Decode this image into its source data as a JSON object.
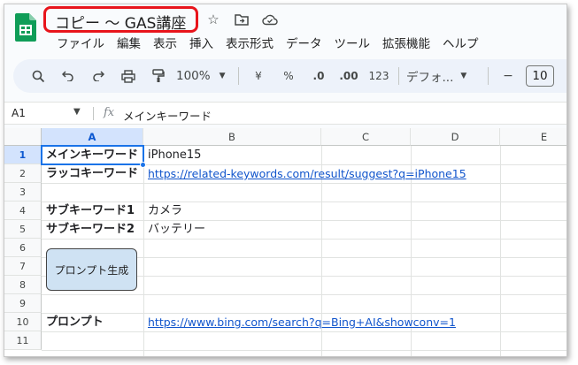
{
  "doc": {
    "title": "コピー 〜 GAS講座"
  },
  "menu": [
    "ファイル",
    "編集",
    "表示",
    "挿入",
    "表示形式",
    "データ",
    "ツール",
    "拡張機能",
    "ヘルプ"
  ],
  "toolbar": {
    "zoom": "100%",
    "currency": "¥",
    "percent": "%",
    "dec_decrease": ".0",
    "dec_increase": ".00",
    "num_format": "123",
    "font": "デフォ...",
    "font_size": "10",
    "minus": "−",
    "plus": "+"
  },
  "formula_bar": {
    "name_box": "A1",
    "fx": "fx",
    "value": "メインキーワード"
  },
  "columns": [
    "A",
    "B",
    "C",
    "D",
    "E"
  ],
  "rows": [
    "1",
    "2",
    "3",
    "4",
    "5",
    "6",
    "7",
    "8",
    "9",
    "10",
    "11"
  ],
  "cells": {
    "a1": "メインキーワード",
    "b1": "iPhone15",
    "a2": "ラッコキーワード",
    "b2": "https://related-keywords.com/result/suggest?q=iPhone15",
    "a4": "サブキーワード1",
    "b4": "カメラ",
    "a5": "サブキーワード2",
    "b5": "バッテリー",
    "a10": "プロンプト",
    "b10": "https://www.bing.com/search?q=Bing+AI&showconv=1"
  },
  "drawing_button": {
    "label": "プロンプト生成"
  },
  "colors": {
    "accent": "#1a73e8",
    "link": "#1155cc",
    "highlight": "#e8141b",
    "button_fill": "#cfe2f3"
  }
}
